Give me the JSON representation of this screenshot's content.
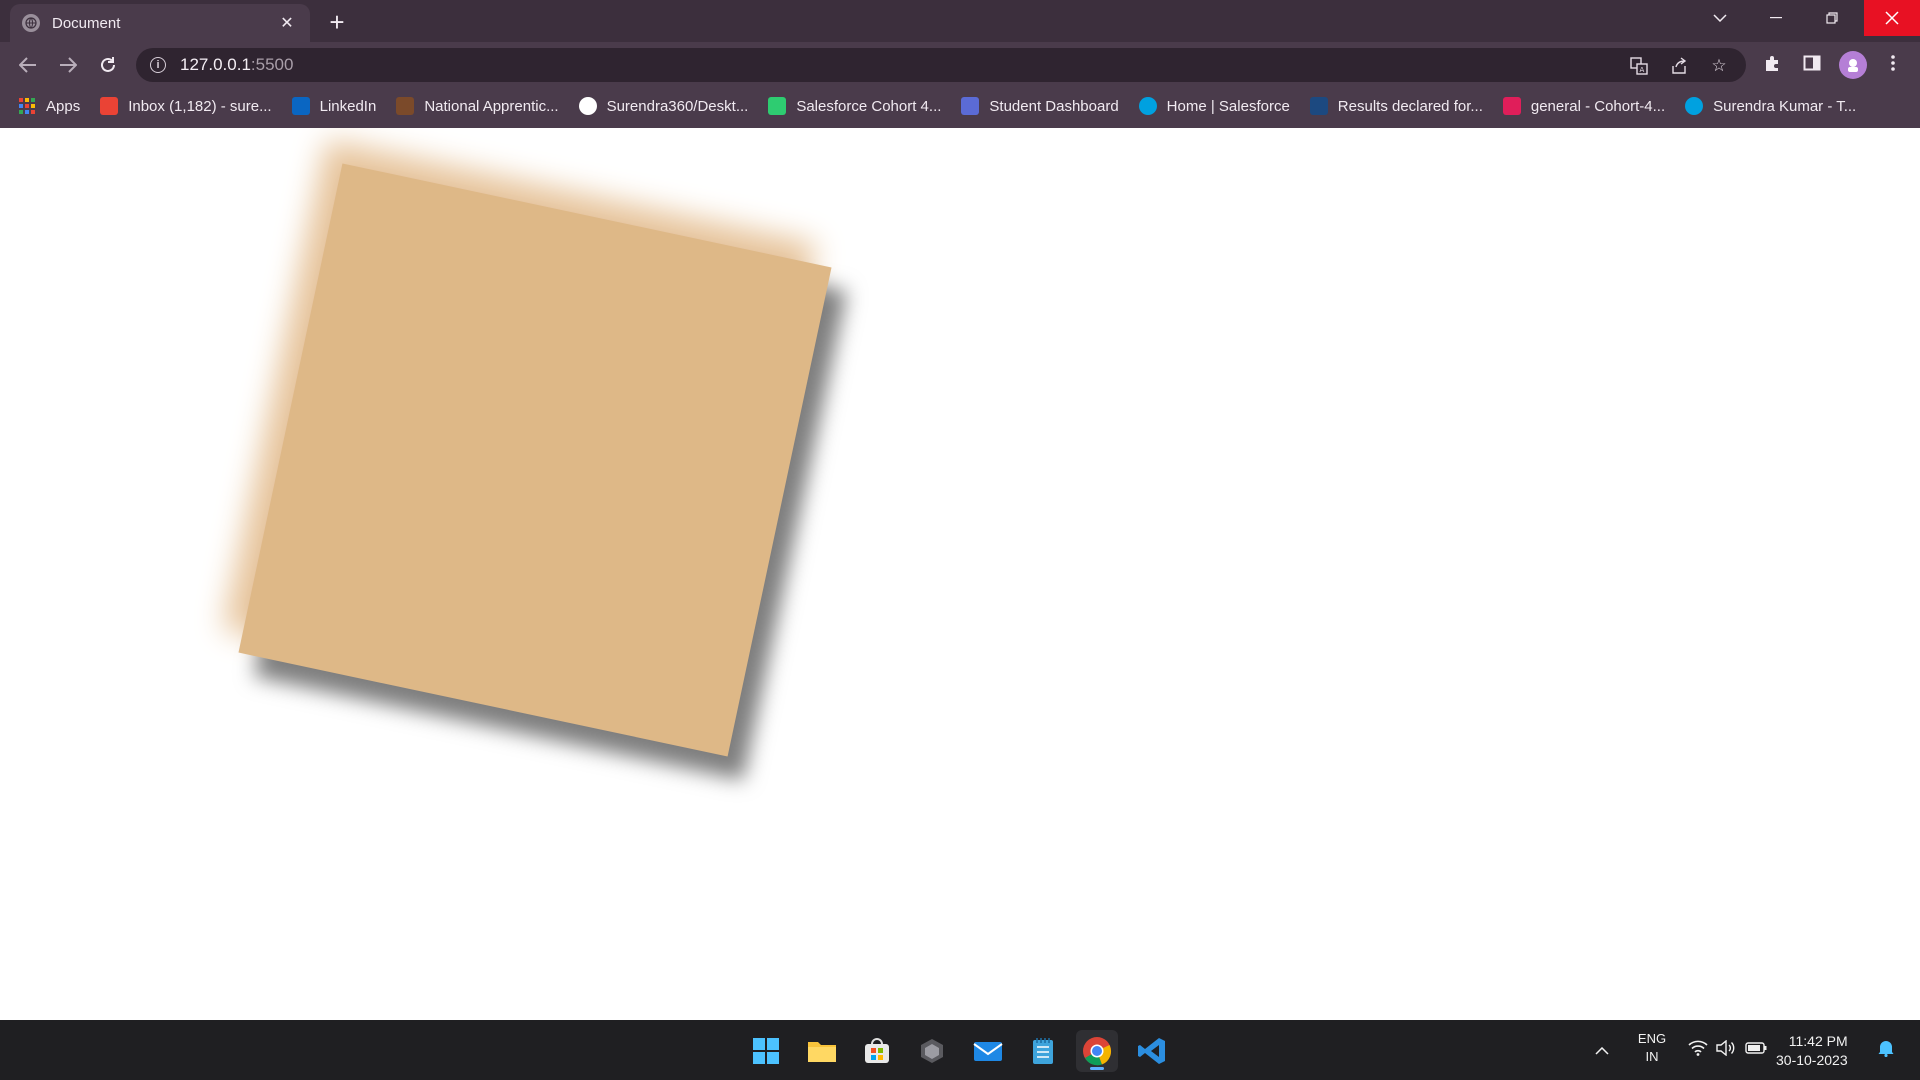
{
  "browser": {
    "tab_title": "Document",
    "url_host": "127.0.0.1",
    "url_port": ":5500",
    "bookmarks": [
      {
        "label": "Apps",
        "icon": "apps-grid-icon",
        "color": "#4285f4"
      },
      {
        "label": "Inbox (1,182) - sure...",
        "icon": "gmail-icon",
        "color": "#ea4335"
      },
      {
        "label": "LinkedIn",
        "icon": "linkedin-icon",
        "color": "#0a66c2"
      },
      {
        "label": "National Apprentic...",
        "icon": "apprenticeship-icon",
        "color": "#7b4a2a"
      },
      {
        "label": "Surendra360/Deskt...",
        "icon": "github-icon",
        "color": "#ffffff"
      },
      {
        "label": "Salesforce Cohort 4...",
        "icon": "trailhead-icon",
        "color": "#2ecc71"
      },
      {
        "label": "Student Dashboard",
        "icon": "dashboard-icon",
        "color": "#5b6bd6"
      },
      {
        "label": "Home | Salesforce",
        "icon": "salesforce-icon",
        "color": "#00a1e0"
      },
      {
        "label": "Results declared for...",
        "icon": "unstop-icon",
        "color": "#1c4980"
      },
      {
        "label": "general - Cohort-4...",
        "icon": "slack-icon",
        "color": "#e01e5a"
      },
      {
        "label": "Surendra Kumar - T...",
        "icon": "salesforce-icon",
        "color": "#00a1e0"
      }
    ]
  },
  "page": {
    "card_color": "#deb887"
  },
  "taskbar": {
    "lang_top": "ENG",
    "lang_bottom": "IN",
    "time": "11:42 PM",
    "date": "30-10-2023"
  }
}
